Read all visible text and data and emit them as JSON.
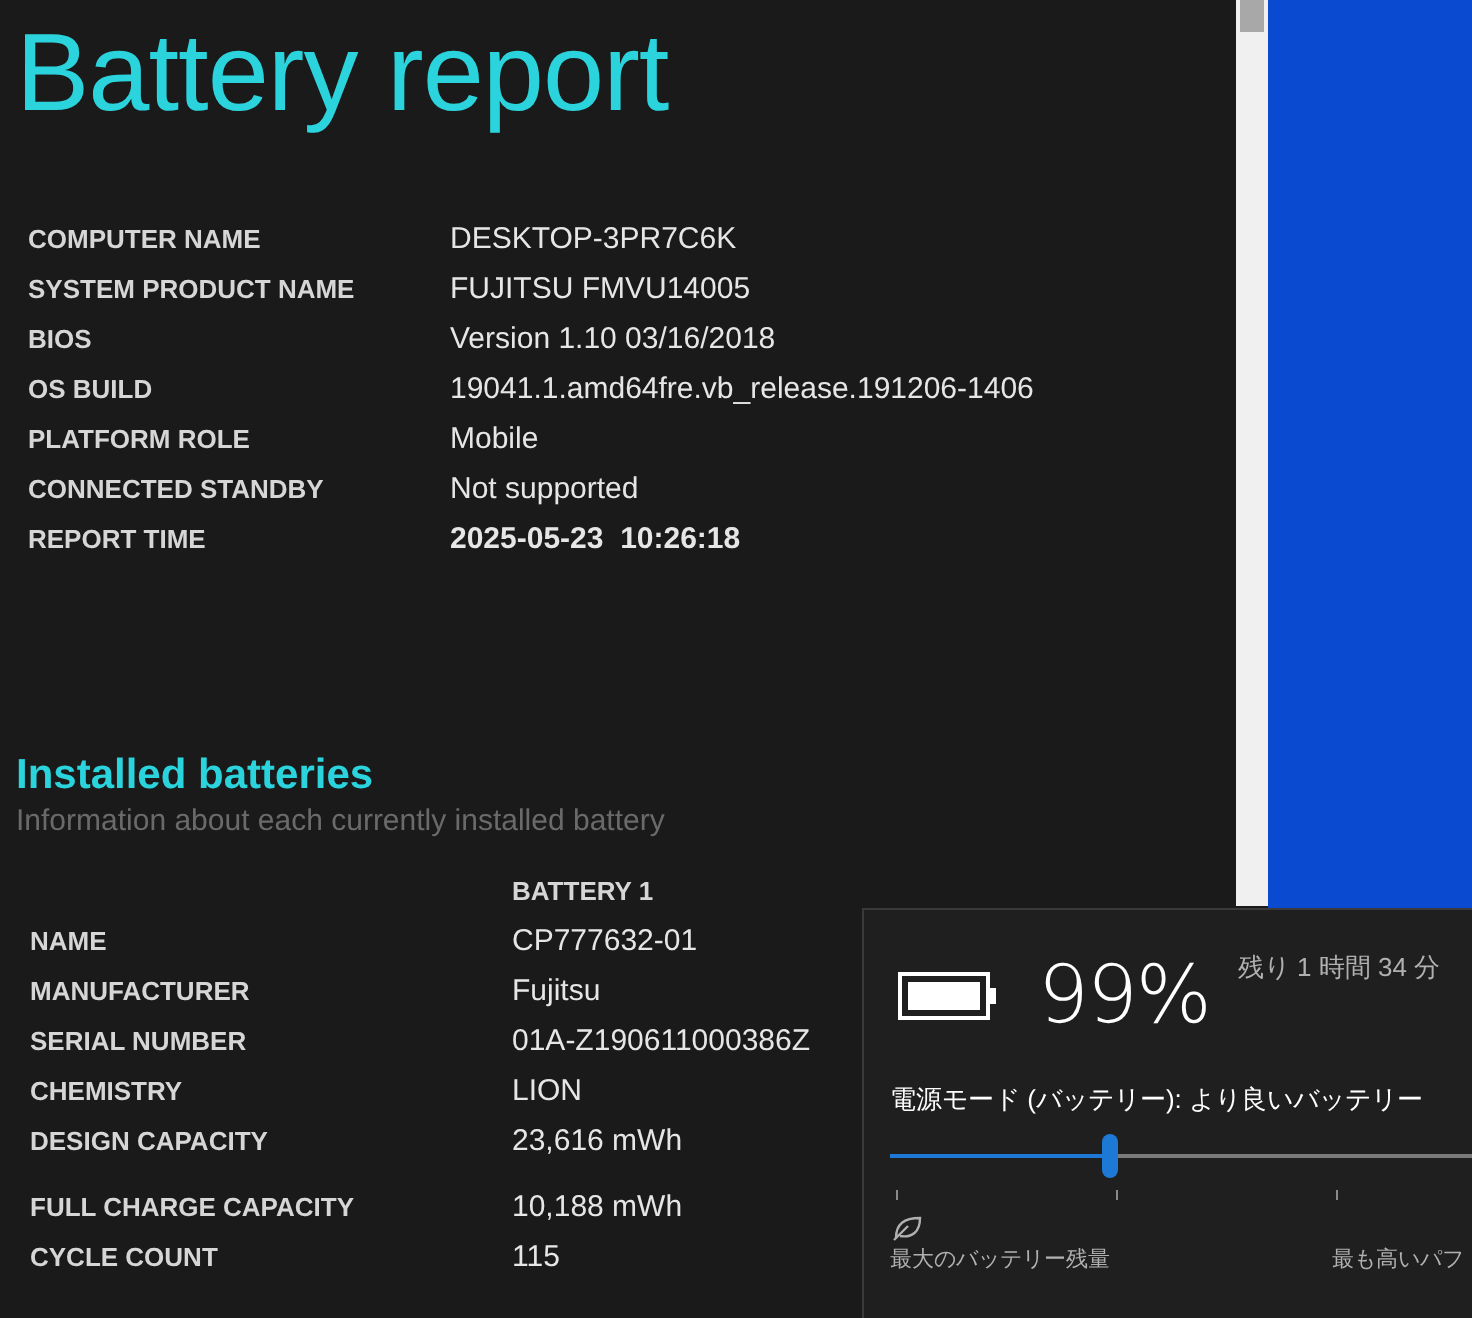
{
  "report": {
    "title": "Battery report",
    "system_info": [
      {
        "label": "COMPUTER NAME",
        "value": "DESKTOP-3PR7C6K",
        "emphasis": false
      },
      {
        "label": "SYSTEM PRODUCT NAME",
        "value": "FUJITSU FMVU14005",
        "emphasis": false
      },
      {
        "label": "BIOS",
        "value": "Version 1.10 03/16/2018",
        "emphasis": false
      },
      {
        "label": "OS BUILD",
        "value": "19041.1.amd64fre.vb_release.191206-1406",
        "emphasis": false
      },
      {
        "label": "PLATFORM ROLE",
        "value": "Mobile",
        "emphasis": false
      },
      {
        "label": "CONNECTED STANDBY",
        "value": "Not supported",
        "emphasis": false
      },
      {
        "label": "REPORT TIME",
        "value": "2025-05-23  10:26:18",
        "emphasis": true
      }
    ],
    "installed_batteries": {
      "heading": "Installed batteries",
      "subtitle": "Information about each currently installed battery",
      "column": "BATTERY 1",
      "row_groups": [
        [
          {
            "label": "NAME",
            "value": "CP777632-01"
          },
          {
            "label": "MANUFACTURER",
            "value": "Fujitsu"
          },
          {
            "label": "SERIAL NUMBER",
            "value": "01A-Z190611000386Z"
          },
          {
            "label": "CHEMISTRY",
            "value": "LION"
          },
          {
            "label": "DESIGN CAPACITY",
            "value": "23,616 mWh"
          }
        ],
        [
          {
            "label": "FULL CHARGE CAPACITY",
            "value": "10,188 mWh"
          },
          {
            "label": "CYCLE COUNT",
            "value": "115"
          }
        ]
      ]
    }
  },
  "battery_flyout": {
    "percent": "99%",
    "remaining": "残り 1 時間 34 分",
    "power_mode": "電源モード (バッテリー): より良いバッテリー",
    "slider": {
      "level": 0.333
    },
    "left_label": "最大のバッテリー残量",
    "right_label": "最も高いパフ"
  }
}
